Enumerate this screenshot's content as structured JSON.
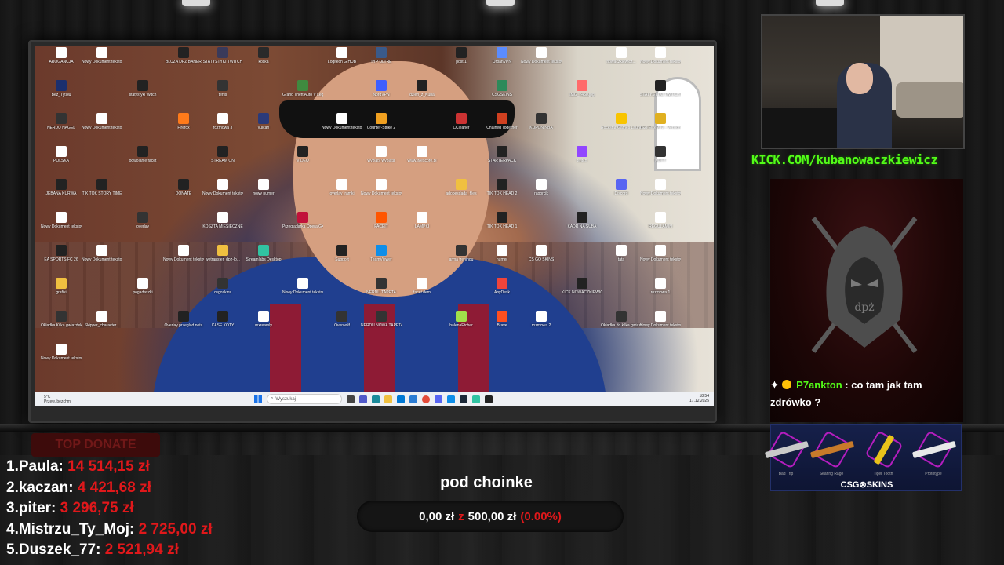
{
  "desktop": {
    "icons": [
      {
        "label": "AROGANCJA",
        "color": "#ffffff"
      },
      {
        "label": "Nowy Dokument tekstowy (2)",
        "color": "#ffffff"
      },
      {
        "label": "BLUZA DPZ BANER",
        "color": "#222222"
      },
      {
        "label": "STATYSTYKI TWITCH",
        "color": "#3a3a5a"
      },
      {
        "label": "koska",
        "color": "#2a2a2a"
      },
      {
        "label": "Logitech G HUB",
        "color": "#ffffff"
      },
      {
        "label": "TYP ULTRE",
        "color": "#3a5a8a"
      },
      {
        "label": "post 1",
        "color": "#222222"
      },
      {
        "label": "UrbanVPN",
        "color": "#5b8cff"
      },
      {
        "label": "Nowy Dokument tekstowy (13)",
        "color": "#ffffff"
      },
      {
        "label": "nowaczkiewicz...",
        "color": "#ffffff"
      },
      {
        "label": "Nowy Dokument tekstowy (29)",
        "color": "#ffffff"
      },
      {
        "label": "Bez_Tytułu",
        "color": "#1b2f6e"
      },
      {
        "label": "statystyki twitch",
        "color": "#222222"
      },
      {
        "label": "tenis",
        "color": "#333333"
      },
      {
        "label": "Grand Theft Auto V Legacy",
        "color": "#3f8a3f"
      },
      {
        "label": "NordVPN",
        "color": "#3e5fff"
      },
      {
        "label": "dzien_z_Kuba",
        "color": "#222222"
      },
      {
        "label": "CSGSKINS",
        "color": "#2d8a5a"
      },
      {
        "label": "IMG_7450.jpg",
        "color": "#ff6b6b"
      },
      {
        "label": "STATYSTYKI TWITCH NAJLEPSZE",
        "color": "#222222"
      },
      {
        "label": "NERDU NAGEL",
        "color": "#333333"
      },
      {
        "label": "Nowy Dokument tekstowy (11)",
        "color": "#ffffff"
      },
      {
        "label": "Firefox",
        "color": "#ff7a1a"
      },
      {
        "label": "rozmowa 3",
        "color": "#ffffff"
      },
      {
        "label": "vulcan",
        "color": "#2a3a7a"
      },
      {
        "label": "Nowy Dokument tekstowy (15)",
        "color": "#ffffff"
      },
      {
        "label": "Counter-Strike 2",
        "color": "#f0a020"
      },
      {
        "label": "CCleaner",
        "color": "#c33"
      },
      {
        "label": "Chained Together",
        "color": "#d04020"
      },
      {
        "label": "KUPON NBA",
        "color": "#333333"
      },
      {
        "label": "Rockstar Games Launcher",
        "color": "#f8c400"
      },
      {
        "label": "(S2) EliteMT2 - Version 1.0.0",
        "color": "#e0b020"
      },
      {
        "label": "POLSKA",
        "color": "#ffffff"
      },
      {
        "label": "odwolanie facet",
        "color": "#222222"
      },
      {
        "label": "STREAM ON",
        "color": "#222222"
      },
      {
        "label": "VIDEO",
        "color": "#222222"
      },
      {
        "label": "wyplaty wyplata",
        "color": "#ffffff"
      },
      {
        "label": "www.livescore.pl",
        "color": "#ffffff"
      },
      {
        "label": "STARTERPACK",
        "color": "#222222"
      },
      {
        "label": "twitch",
        "color": "#9146ff"
      },
      {
        "label": "KOTY",
        "color": "#333333"
      },
      {
        "label": "JEBANA KURWA",
        "color": "#222222"
      },
      {
        "label": "TIK TOK STORY TIME",
        "color": "#222222"
      },
      {
        "label": "DONATE",
        "color": "#222222"
      },
      {
        "label": "Nowy Dokument tekstowy (18)",
        "color": "#ffffff"
      },
      {
        "label": "nowy numer",
        "color": "#ffffff"
      },
      {
        "label": "overlay_ramki",
        "color": "#ffffff"
      },
      {
        "label": "Nowy Dokument tekstowy (14)",
        "color": "#ffffff"
      },
      {
        "label": "adobesdada_files",
        "color": "#f0c040"
      },
      {
        "label": "TIK TOK HEAD 2",
        "color": "#222222"
      },
      {
        "label": "raporcik",
        "color": "#ffffff"
      },
      {
        "label": "Discord",
        "color": "#5865f2"
      },
      {
        "label": "Nowy Dokument tekstowy (19)",
        "color": "#ffffff"
      },
      {
        "label": "Nowy Dokument tekstowy (17)",
        "color": "#ffffff"
      },
      {
        "label": "overlay",
        "color": "#333333"
      },
      {
        "label": "KOSZTA MIESIECZNE",
        "color": "#ffffff"
      },
      {
        "label": "Przegladarka Opera GX",
        "color": "#c1123a"
      },
      {
        "label": "FACEIT",
        "color": "#ff5500"
      },
      {
        "label": "LAMPKI",
        "color": "#ffffff"
      },
      {
        "label": "TIK TOK HEAD 1",
        "color": "#222222"
      },
      {
        "label": "KADR NA SUBA",
        "color": "#222222"
      },
      {
        "label": "REGULAMIN",
        "color": "#ffffff"
      },
      {
        "label": "EA SPORTS FC 26",
        "color": "#222222"
      },
      {
        "label": "Nowy Dokument tekstowy (21)",
        "color": "#ffffff"
      },
      {
        "label": "Nowy Dokument tekstowy (33)",
        "color": "#ffffff"
      },
      {
        "label": "wetransfer_dpz-lo...",
        "color": "#f0c040"
      },
      {
        "label": "Streamlabs Desktop",
        "color": "#31c3a2"
      },
      {
        "label": "Support",
        "color": "#222222"
      },
      {
        "label": "TeamViewer",
        "color": "#0e8ee9"
      },
      {
        "label": "arma treningu",
        "color": "#333333"
      },
      {
        "label": "numer",
        "color": "#ffffff"
      },
      {
        "label": "CS GO SKINS",
        "color": "#ffffff"
      },
      {
        "label": "tata",
        "color": "#ffffff"
      },
      {
        "label": "Nowy Dokument tekstowy (23)",
        "color": "#ffffff"
      },
      {
        "label": "grafiki",
        "color": "#f0c040"
      },
      {
        "label": "pogadaszki",
        "color": "#ffffff"
      },
      {
        "label": "csgoskins",
        "color": "#333333"
      },
      {
        "label": "Nowy Dokument tekstowy (27)",
        "color": "#ffffff"
      },
      {
        "label": "NERDU TAPETA",
        "color": "#333333"
      },
      {
        "label": "facet.dem",
        "color": "#ffffff"
      },
      {
        "label": "AnyDesk",
        "color": "#ef443b"
      },
      {
        "label": "KICK NOWACZKIEWICZ",
        "color": "#222222"
      },
      {
        "label": "rozmowa 1",
        "color": "#ffffff"
      },
      {
        "label": "Okładka Kilka gwiazdek",
        "color": "#333333"
      },
      {
        "label": "Skipper_character...",
        "color": "#ffffff"
      },
      {
        "label": "Overlay przeglad neta",
        "color": "#222222"
      },
      {
        "label": "CASE KOTY",
        "color": "#222222"
      },
      {
        "label": "mxreamly",
        "color": "#ffffff"
      },
      {
        "label": "Overwolf",
        "color": "#333333"
      },
      {
        "label": "NERDU NOWA TAPETA",
        "color": "#333333"
      },
      {
        "label": "balenaEtcher",
        "color": "#a1e04a"
      },
      {
        "label": "Brave",
        "color": "#ff4f1f"
      },
      {
        "label": "rozmowa 2",
        "color": "#ffffff"
      },
      {
        "label": "Okładka do kilka gwiazdek poprawna",
        "color": "#333333"
      },
      {
        "label": "Nowy Dokument tekstowy (20)",
        "color": "#ffffff"
      },
      {
        "label": "Nowy Dokument tekstowy (22)",
        "color": "#ffffff"
      }
    ],
    "taskbar": {
      "weather_temp": "5°C",
      "weather_desc": "Przew. bezchm.",
      "search_placeholder": "Wyszukaj",
      "time": "18:54",
      "date": "17.12.2025"
    }
  },
  "webcam_link": "KICK.COM/kubanowaczkiewicz",
  "emblem_text": "dpż",
  "chat": {
    "user": "P7ankton",
    "message": ": co tam jak tam zdrówko ?"
  },
  "sponsor": {
    "skins": [
      "Bad Trip",
      "Searing Rage",
      "Tiger Tooth",
      "Prototype"
    ],
    "logo": "CSG⊗SKINS"
  },
  "top_donate": {
    "title": "TOP DONATE",
    "entries": [
      {
        "rank": "1.",
        "name": "Paula:",
        "amount": "14 514,15 zł"
      },
      {
        "rank": "2.",
        "name": "kaczan:",
        "amount": "4 421,68 zł"
      },
      {
        "rank": "3.",
        "name": "piter:",
        "amount": "3 296,75 zł"
      },
      {
        "rank": "4.",
        "name": "Mistrzu_Ty_Moj:",
        "amount": "2 725,00 zł"
      },
      {
        "rank": "5.",
        "name": "Duszek_77:",
        "amount": "2 521,94 zł"
      }
    ]
  },
  "goal": {
    "title": "pod choinke",
    "current": "0,00 zł",
    "separator": "z",
    "target": "500,00 zł",
    "percent": "(0.00%)",
    "progress": 0
  },
  "colors": {
    "kick_green": "#53fc18",
    "donate_red": "#e0181b"
  }
}
